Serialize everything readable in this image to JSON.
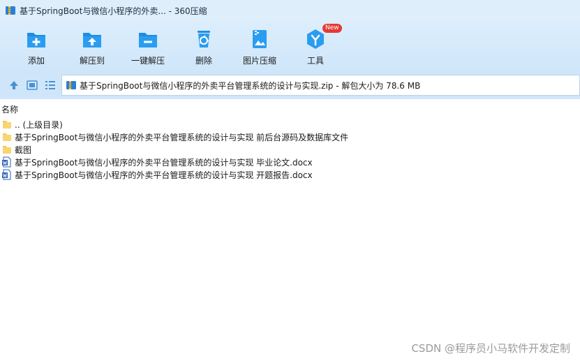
{
  "window": {
    "title": "基于SpringBoot与微信小程序的外卖... - 360压缩"
  },
  "toolbar": {
    "items": [
      {
        "label": "添加",
        "icon": "add-icon"
      },
      {
        "label": "解压到",
        "icon": "extract-to-icon"
      },
      {
        "label": "一键解压",
        "icon": "one-click-extract-icon"
      },
      {
        "label": "删除",
        "icon": "delete-icon"
      },
      {
        "label": "图片压缩",
        "icon": "image-compress-icon"
      },
      {
        "label": "工具",
        "icon": "tools-icon",
        "badge": "New"
      }
    ]
  },
  "address": {
    "path": "基于SpringBoot与微信小程序的外卖平台管理系统的设计与实现.zip - 解包大小为 78.6 MB"
  },
  "filelist": {
    "column_name": "名称",
    "items": [
      {
        "name": ".. (上级目录)",
        "type": "folder"
      },
      {
        "name": "基于SpringBoot与微信小程序的外卖平台管理系统的设计与实现 前后台源码及数据库文件",
        "type": "folder"
      },
      {
        "name": "截图",
        "type": "folder"
      },
      {
        "name": "基于SpringBoot与微信小程序的外卖平台管理系统的设计与实现 毕业论文.docx",
        "type": "docx"
      },
      {
        "name": "基于SpringBoot与微信小程序的外卖平台管理系统的设计与实现 开题报告.docx",
        "type": "docx"
      }
    ]
  },
  "watermark": "CSDN @程序员小马软件开发定制",
  "colors": {
    "toolbar_bg": "#cfe6fa",
    "icon_blue": "#1f8ee0",
    "folder_yellow": "#f5c84c",
    "badge_red": "#e53935"
  }
}
